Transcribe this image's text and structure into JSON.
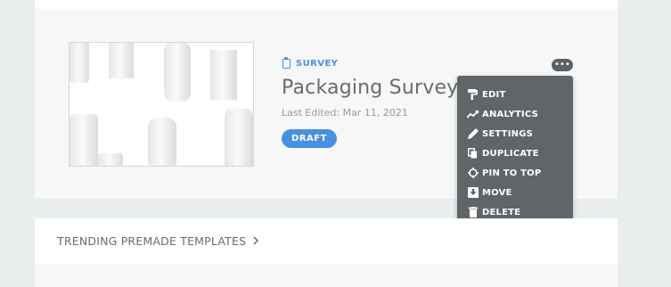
{
  "survey": {
    "type_label": "SURVEY",
    "title": "Packaging Survey",
    "last_edited": "Last Edited: Mar 11, 2021",
    "status": "DRAFT",
    "more_label": "•••"
  },
  "menu": {
    "items": [
      {
        "label": "EDIT",
        "icon": "paint-roller-icon"
      },
      {
        "label": "ANALYTICS",
        "icon": "trend-icon"
      },
      {
        "label": "SETTINGS",
        "icon": "pencil-icon"
      },
      {
        "label": "DUPLICATE",
        "icon": "copy-icon"
      },
      {
        "label": "PIN TO TOP",
        "icon": "crosshair-icon"
      },
      {
        "label": "MOVE",
        "icon": "move-box-icon"
      },
      {
        "label": "DELETE",
        "icon": "trash-icon"
      }
    ]
  },
  "trending": {
    "label": "TRENDING PREMADE TEMPLATES"
  },
  "colors": {
    "accent": "#4a90e2",
    "menu_bg": "#5f6568",
    "page_bg": "#e9edee"
  }
}
